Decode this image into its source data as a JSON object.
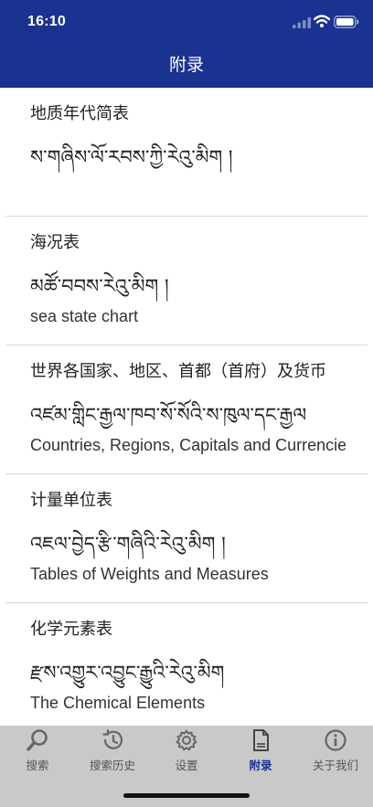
{
  "status_bar": {
    "time": "16:10",
    "icons": [
      "signal-icon",
      "wifi-icon",
      "battery-icon"
    ]
  },
  "header": {
    "title": "附录",
    "color": "#1a3290"
  },
  "entries": [
    {
      "zh": "地质年代简表",
      "bo": "ས་གཞིས་ལོ་རབས་ཀྱི་རེའུ་མིག །",
      "en": ""
    },
    {
      "zh": "海况表",
      "bo": "མཚོ་བབས་རེའུ་མིག །",
      "en": "sea state chart"
    },
    {
      "zh": "世界各国家、地区、首都（首府）及货币",
      "bo": "འཛམ་གླིང་རྒྱལ་ཁབ་སོ་སོའི་ས་ཁུལ་དང་རྒྱལ",
      "en": "Countries, Regions, Capitals and Currencies"
    },
    {
      "zh": "计量单位表",
      "bo": "འཇལ་བྱེད་རྩི་གཞིའི་རེའུ་མིག །",
      "en": "Tables of Weights and Measures"
    },
    {
      "zh": "化学元素表",
      "bo": "རྫས་འགྱུར་འབྱུང་རྒྱུའི་རེའུ་མིག",
      "en": "The Chemical Elements"
    }
  ],
  "tabbar": {
    "tabs": [
      {
        "label": "搜索",
        "icon": "search-icon"
      },
      {
        "label": "搜索历史",
        "icon": "history-icon"
      },
      {
        "label": "设置",
        "icon": "gear-icon"
      },
      {
        "label": "附录",
        "icon": "document-icon",
        "active": true
      },
      {
        "label": "关于我们",
        "icon": "info-icon"
      }
    ],
    "active_color": "#1a3290",
    "inactive_color": "#555555"
  }
}
